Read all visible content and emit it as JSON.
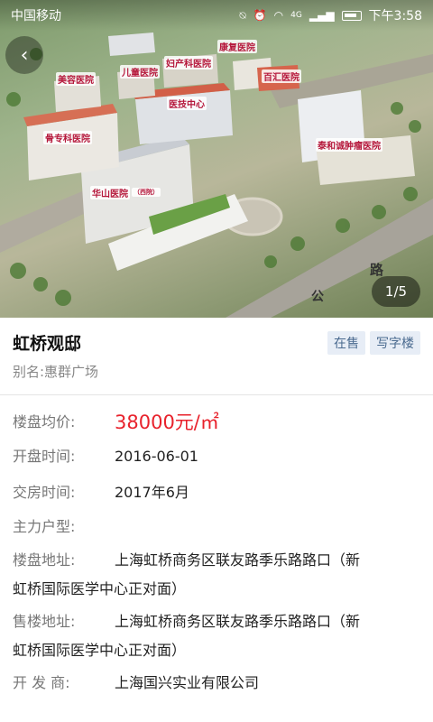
{
  "status_bar": {
    "carrier": "中国移动",
    "time": "下午3:58",
    "icons": [
      "mute-icon",
      "alarm-icon",
      "wifi-icon",
      "4g-icon",
      "signal-icon",
      "battery-icon"
    ]
  },
  "hero": {
    "page_indicator": "1/5",
    "building_labels": [
      "康复医院",
      "妇产科医院",
      "美容医院",
      "儿童医院",
      "百汇医院",
      "医技中心",
      "骨专科医院",
      "泰和诚肿瘤医院",
      "华山医院",
      "（西院）",
      "路",
      "公"
    ]
  },
  "project": {
    "name": "虹桥观邸",
    "tags": [
      "在售",
      "写字楼"
    ],
    "alias": "别名:惠群广场"
  },
  "details": {
    "price_label": "楼盘均价:",
    "price_value": "38000元/㎡",
    "open_label": "开盘时间:",
    "open_value": "2016-06-01",
    "delivery_label": "交房时间:",
    "delivery_value": "2017年6月",
    "layout_label": "主力户型:",
    "layout_value": "",
    "address_label": "楼盘地址:",
    "address_value_1": "上海虹桥商务区联友路季乐路路口（新",
    "address_value_2": "虹桥国际医学中心正对面）",
    "sales_label": "售楼地址:",
    "sales_value_1": "上海虹桥商务区联友路季乐路路口（新",
    "sales_value_2": "虹桥国际医学中心正对面）",
    "developer_label": "开 发 商:",
    "developer_value": "上海国兴实业有限公司"
  },
  "colors": {
    "price": "#e8222c",
    "tag_bg": "#e7edf6",
    "tag_text": "#4a6a8f"
  }
}
